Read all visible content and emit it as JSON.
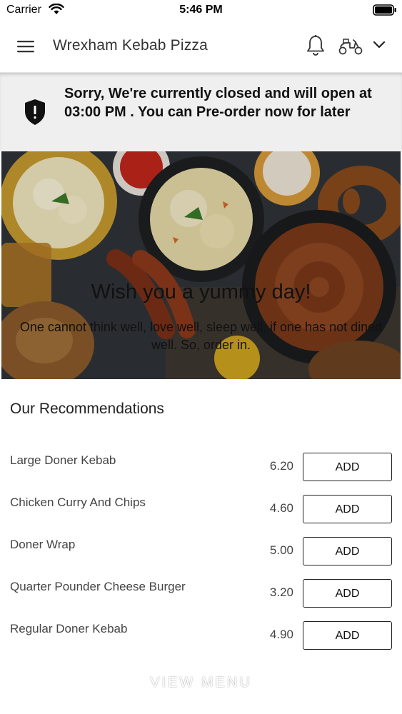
{
  "status_bar": {
    "carrier": "Carrier",
    "time": "5:46 PM",
    "icons": [
      "wifi-icon",
      "battery-icon"
    ]
  },
  "header": {
    "title": "Wrexham Kebab Pizza",
    "icons": [
      "menu-icon",
      "bell-icon",
      "scooter-icon",
      "chevron-down-icon"
    ]
  },
  "banner": {
    "icon": "shield-alert-icon",
    "message": "Sorry, We're currently closed and will open at 03:00 PM . You can Pre-order now for later"
  },
  "hero": {
    "title": "Wish you a yummy day!",
    "subtitle": "One cannot think well, love well, sleep well, if one has not dined well. So, order in."
  },
  "recommendations": {
    "heading": "Our Recommendations",
    "add_label": "ADD",
    "items": [
      {
        "name": "Large Doner Kebab",
        "price": "6.20"
      },
      {
        "name": "Chicken Curry And Chips",
        "price": "4.60"
      },
      {
        "name": "Doner Wrap",
        "price": "5.00"
      },
      {
        "name": "Quarter Pounder Cheese Burger",
        "price": "3.20"
      },
      {
        "name": "Regular Doner Kebab",
        "price": "4.90"
      }
    ]
  },
  "footer": {
    "view_menu_label": "VIEW MENU"
  },
  "colors": {
    "banner_bg": "#efefef",
    "button_border": "#222222",
    "text": "#222222"
  }
}
